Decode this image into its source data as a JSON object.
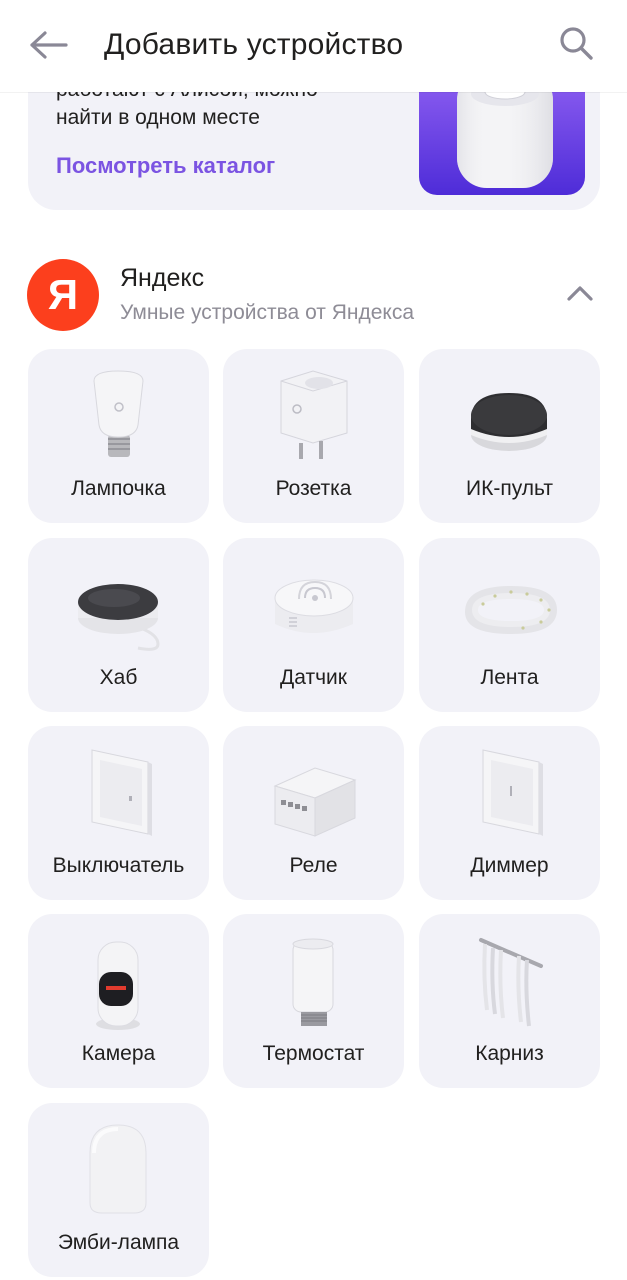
{
  "header": {
    "title": "Добавить устройство"
  },
  "promo": {
    "text_line1": "работают с Алисой, можно",
    "text_line2": "найти в одном месте",
    "link": "Посмотреть каталог"
  },
  "brand": {
    "logo_letter": "Я",
    "name": "Яндекс",
    "subtitle": "Умные устройства от Яндекса",
    "logo_color": "#fc3f1d"
  },
  "devices": [
    {
      "label": "Лампочка",
      "icon": "bulb-icon"
    },
    {
      "label": "Розетка",
      "icon": "socket-icon"
    },
    {
      "label": "ИК-пульт",
      "icon": "ir-remote-icon"
    },
    {
      "label": "Хаб",
      "icon": "hub-icon"
    },
    {
      "label": "Датчик",
      "icon": "sensor-icon"
    },
    {
      "label": "Лента",
      "icon": "led-strip-icon"
    },
    {
      "label": "Выключатель",
      "icon": "switch-icon"
    },
    {
      "label": "Реле",
      "icon": "relay-icon"
    },
    {
      "label": "Диммер",
      "icon": "dimmer-icon"
    },
    {
      "label": "Камера",
      "icon": "camera-icon"
    },
    {
      "label": "Термостат",
      "icon": "thermostat-icon"
    },
    {
      "label": "Карниз",
      "icon": "curtain-rail-icon"
    },
    {
      "label": "Эмби-лампа",
      "icon": "ambient-lamp-icon"
    }
  ],
  "colors": {
    "accent": "#7b54e2",
    "tile_bg": "#f2f2f8",
    "secondary_text": "#8e8c96"
  }
}
